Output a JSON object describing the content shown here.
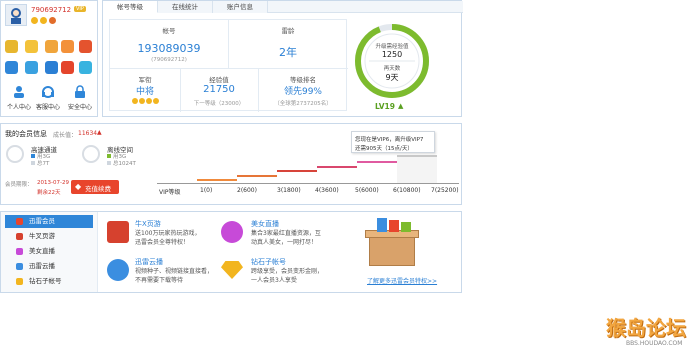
{
  "profile": {
    "username": "790692712",
    "vip_badge": "VIP",
    "links": [
      {
        "label": "个人中心"
      },
      {
        "label": "客服中心"
      },
      {
        "label": "安全中心"
      }
    ]
  },
  "tabs": [
    "帐号等级",
    "在线统计",
    "账户信息"
  ],
  "account": {
    "id_title": "帐号",
    "id_value": "193089039",
    "id_sub": "(790692712)",
    "age_title": "雷龄",
    "age_value": "2年",
    "military_title": "军衔",
    "military_value": "中将",
    "exp_title": "经验值",
    "exp_value": "21750",
    "exp_sub": "下一等级（23000）",
    "rank_title": "等级排名",
    "rank_value": "领先99%",
    "rank_sub": "（全球第2737205名）"
  },
  "level": {
    "upgrade_label": "升级需经验值",
    "upgrade_value": "1250",
    "days_label": "再天数",
    "days_value": "9天",
    "level_label": "LV19",
    "progress": 0.94
  },
  "membership": {
    "title": "我的会员信息",
    "growth_label": "成长值：",
    "growth_value": "11634",
    "tooltip_line1": "您现在是VIP6，离升级VIP7",
    "tooltip_line2": "还需905天（15点/天）",
    "services": [
      {
        "name": "高速通道",
        "used_label": "用3G",
        "total_label": "总7T"
      },
      {
        "name": "离线空间",
        "used_label": "用3G",
        "total_label": "总1024T"
      }
    ],
    "expire_label": "会员期限：",
    "expire_value": "2013-07-29",
    "remaining": "剩余22天",
    "recharge_button": "充值续费",
    "steps": [
      "VIP等级",
      "1(0)",
      "2(600)",
      "3(1800)",
      "4(3600)",
      "5(6000)",
      "6(10800)",
      "7(25200)"
    ]
  },
  "sidebar": {
    "items": [
      {
        "label": "迅雷会员",
        "active": true,
        "color": "#e8452c"
      },
      {
        "label": "牛叉页游",
        "active": false,
        "color": "#d6412e"
      },
      {
        "label": "美女直播",
        "active": false,
        "color": "#c74ad8"
      },
      {
        "label": "迅雷云播",
        "active": false,
        "color": "#3b8ee0"
      },
      {
        "label": "钻石子帐号",
        "active": false,
        "color": "#f2b51f"
      }
    ]
  },
  "features": [
    {
      "title": "牛X页游",
      "desc1": "送100万玩家热玩游戏，",
      "desc2": "迅雷会员全尊特权！"
    },
    {
      "title": "美女直播",
      "desc1": "集合3家最红直播资源，互",
      "desc2": "动真人美女，一网打尽！"
    },
    {
      "title": "迅雷云播",
      "desc1": "视频种子、视频链接直接看，",
      "desc2": "不再需要下载等待"
    },
    {
      "title": "钻石子帐号",
      "desc1": "跨级享受，会员变形金刚，",
      "desc2": "一人会员3人享受"
    }
  ],
  "promo_link": "了解更多迅雷会员特权>>",
  "watermark": {
    "brand": "猴岛论坛",
    "url": "BBS.HOUDAO.COM"
  }
}
